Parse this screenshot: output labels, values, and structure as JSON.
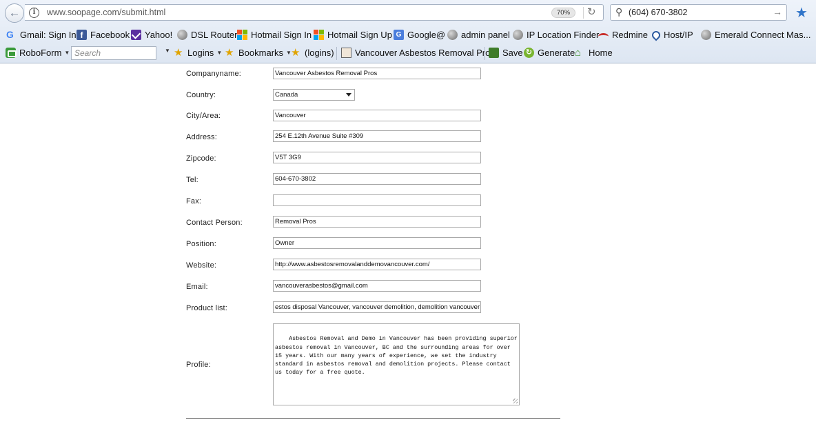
{
  "browser": {
    "url": "www.soopage.com/submit.html",
    "zoom": "70%",
    "search_value": "(604) 670-3802"
  },
  "bookmarks": [
    {
      "label": "Gmail: Sign In",
      "icon": "google-icon"
    },
    {
      "label": "Facebook",
      "icon": "facebook-icon"
    },
    {
      "label": "Yahoo!",
      "icon": "yahoo-mail-icon"
    },
    {
      "label": "DSL Router",
      "icon": "globe-icon"
    },
    {
      "label": "Hotmail Sign In",
      "icon": "microsoft-icon"
    },
    {
      "label": "Hotmail Sign Up",
      "icon": "microsoft-icon"
    },
    {
      "label": "Google@",
      "icon": "google-translate-icon"
    },
    {
      "label": "admin panel",
      "icon": "globe-icon"
    },
    {
      "label": "IP Location Finder",
      "icon": "globe-icon"
    },
    {
      "label": "Redmine",
      "icon": "redmine-icon"
    },
    {
      "label": "Host/IP",
      "icon": "location-pin-icon"
    },
    {
      "label": "Emerald Connect Mas...",
      "icon": "globe-icon"
    }
  ],
  "toolbar": {
    "roboform": "RoboForm",
    "search_placeholder": "Search",
    "logins": "Logins",
    "bookmarks": "Bookmarks",
    "logins_paren": "(logins)",
    "page_title": "Vancouver Asbestos Removal Pros",
    "save": "Save",
    "generate": "Generate",
    "home": "Home"
  },
  "form": {
    "fields": [
      {
        "label": "Companyname:",
        "value": "Vancouver Asbestos Removal Pros"
      },
      {
        "label": "Country:",
        "value": "Canada"
      },
      {
        "label": "City/Area:",
        "value": "Vancouver"
      },
      {
        "label": "Address:",
        "value": "254 E.12th Avenue Suite #309"
      },
      {
        "label": "Zipcode:",
        "value": "V5T 3G9"
      },
      {
        "label": "Tel:",
        "value": "604-670-3802"
      },
      {
        "label": "Fax:",
        "value": ""
      },
      {
        "label": "Contact Person:",
        "value": "Removal Pros"
      },
      {
        "label": "Position:",
        "value": "Owner"
      },
      {
        "label": "Website:",
        "value": "http://www.asbestosremovalanddemovancouver.com/"
      },
      {
        "label": "Email:",
        "value": "vancouverasbestos@gmail.com"
      },
      {
        "label": "Product list:",
        "value": "estos disposal Vancouver, vancouver demolition, demolition vancouver"
      },
      {
        "label": "Profile:",
        "value": "Asbestos Removal and Demo in Vancouver has been providing superior asbestos removal in Vancouver, BC and the surrounding areas for over 15 years. With our many years of experience, we set the industry standard in asbestos removal and demolition projects. Please contact us today for a free quote."
      }
    ]
  }
}
